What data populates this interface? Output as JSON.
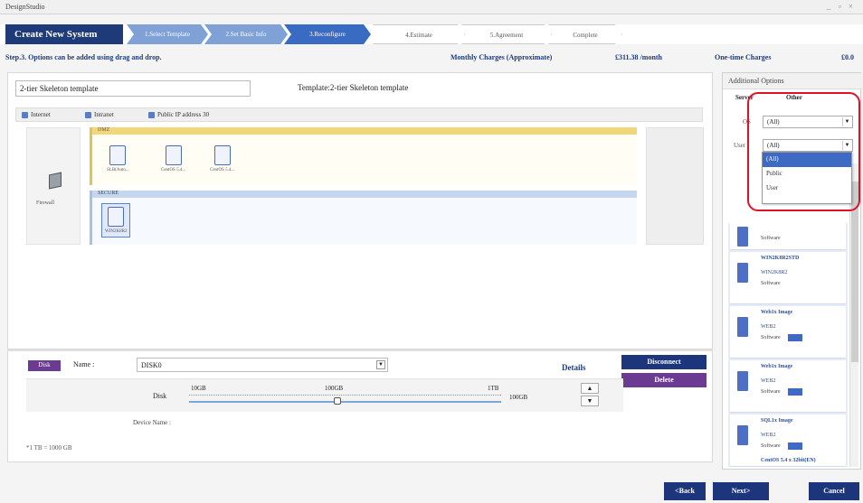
{
  "app": {
    "title": "DesignStudio",
    "controls": "_ ▫ ×"
  },
  "wizard": {
    "title": "Create New System",
    "steps": [
      {
        "label": "1.Select Template",
        "state": "done"
      },
      {
        "label": "2.Set Basic Info",
        "state": "done"
      },
      {
        "label": "3.Reconfigure",
        "state": "active"
      },
      {
        "label": "4.Estimate",
        "state": "todo"
      },
      {
        "label": "5.Agreement",
        "state": "todo"
      },
      {
        "label": "Complete",
        "state": "todo"
      }
    ]
  },
  "info": {
    "step_text": "Step.3. Options can be added using drag and drop.",
    "monthly_label": "Monthly Charges (Approximate)",
    "monthly_value": "£311.38 /month",
    "onetime_label": "One-time Charges",
    "onetime_value": "£0.0"
  },
  "template": {
    "name_value": "2-tier Skeleton template",
    "title": "Template:2-tier Skeleton template"
  },
  "net_tabs": [
    "Internet",
    "Intranet",
    "Public IP address 30"
  ],
  "firewall": {
    "label": "Firewall"
  },
  "dmz": {
    "label": "DMZ",
    "servers": [
      "SLB(Auto...",
      "CentOS 5.4...",
      "CentOS 5.4..."
    ]
  },
  "secure": {
    "label": "SECURE",
    "servers": [
      "WIN2K8R2"
    ]
  },
  "disk": {
    "tab_label": "Disk",
    "name_label": "Name :",
    "name_value": "DISK0",
    "details_label": "Details",
    "disconnect_label": "Disconnect",
    "delete_label": "Delete",
    "disk_label": "Disk",
    "tick_min": "10GB",
    "tick_mid": "100GB",
    "tick_max": "1TB",
    "value": "100GB",
    "device_name_label": "Device Name :",
    "footnote": "*1 TB = 1000 GB",
    "stepper_up": "▲",
    "stepper_down": "▼"
  },
  "sidebar": {
    "title": "Additional Options",
    "tabs": [
      "Server",
      "Other"
    ],
    "os_label": "OS",
    "os_value": "(All)",
    "user_label": "User",
    "user_value": "(All)",
    "user_options": [
      "(All)",
      "Public",
      "User"
    ],
    "items": [
      {
        "title": "Software",
        "sub": "",
        "kind": ""
      },
      {
        "title": "WIN2K8R2STD",
        "sub": "WIN2K8R2",
        "kind": "Software"
      },
      {
        "title": "Web1x Image",
        "sub": "WEB2",
        "kind": "Software"
      },
      {
        "title": "Web1x Image",
        "sub": "WEB2",
        "kind": "Software"
      },
      {
        "title": "SQL1x Image",
        "sub": "WEB2",
        "kind": "Software"
      },
      {
        "title": "CentOS 5.4 x 32bit(EN)",
        "sub": "",
        "kind": ""
      }
    ]
  },
  "nav": {
    "back": "<Back",
    "next": "Next>",
    "cancel": "Cancel"
  },
  "colors": {
    "brand": "#1e3a78",
    "accent": "#3a6bc2",
    "highlight": "#e0102a",
    "purple": "#6b3a93"
  }
}
